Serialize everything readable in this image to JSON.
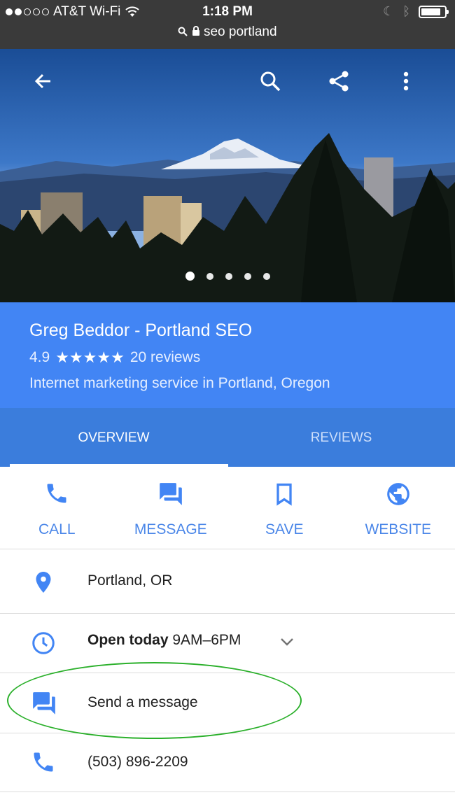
{
  "status_bar": {
    "carrier": "AT&T Wi-Fi",
    "time": "1:18 PM",
    "url": "seo portland",
    "signal_bars_filled": 2,
    "signal_bars_total": 5,
    "battery_level": 0.85
  },
  "hero": {
    "carousel_total": 5,
    "carousel_active": 0,
    "icons": [
      "back-arrow-icon",
      "search-icon",
      "share-icon",
      "more-vert-icon"
    ]
  },
  "business": {
    "name": "Greg Beddor - Portland SEO",
    "rating": "4.9",
    "stars": "★★★★★",
    "reviews": "20 reviews",
    "category": "Internet marketing service in Portland, Oregon"
  },
  "tabs": [
    {
      "label": "OVERVIEW",
      "active": true
    },
    {
      "label": "REVIEWS",
      "active": false
    }
  ],
  "actions": [
    {
      "label": "CALL",
      "icon": "phone-icon"
    },
    {
      "label": "MESSAGE",
      "icon": "message-icon"
    },
    {
      "label": "SAVE",
      "icon": "bookmark-icon"
    },
    {
      "label": "WEBSITE",
      "icon": "globe-icon"
    }
  ],
  "details": {
    "location": "Portland, OR",
    "hours_status": "Open today",
    "hours": "9AM–6PM",
    "message": "Send a message",
    "phone": "(503) 896-2209"
  },
  "colors": {
    "accent": "#4285f4",
    "tab_bar": "#3b7ddc",
    "status_bar": "#3a3a3a",
    "highlight": "#2bb02b"
  }
}
